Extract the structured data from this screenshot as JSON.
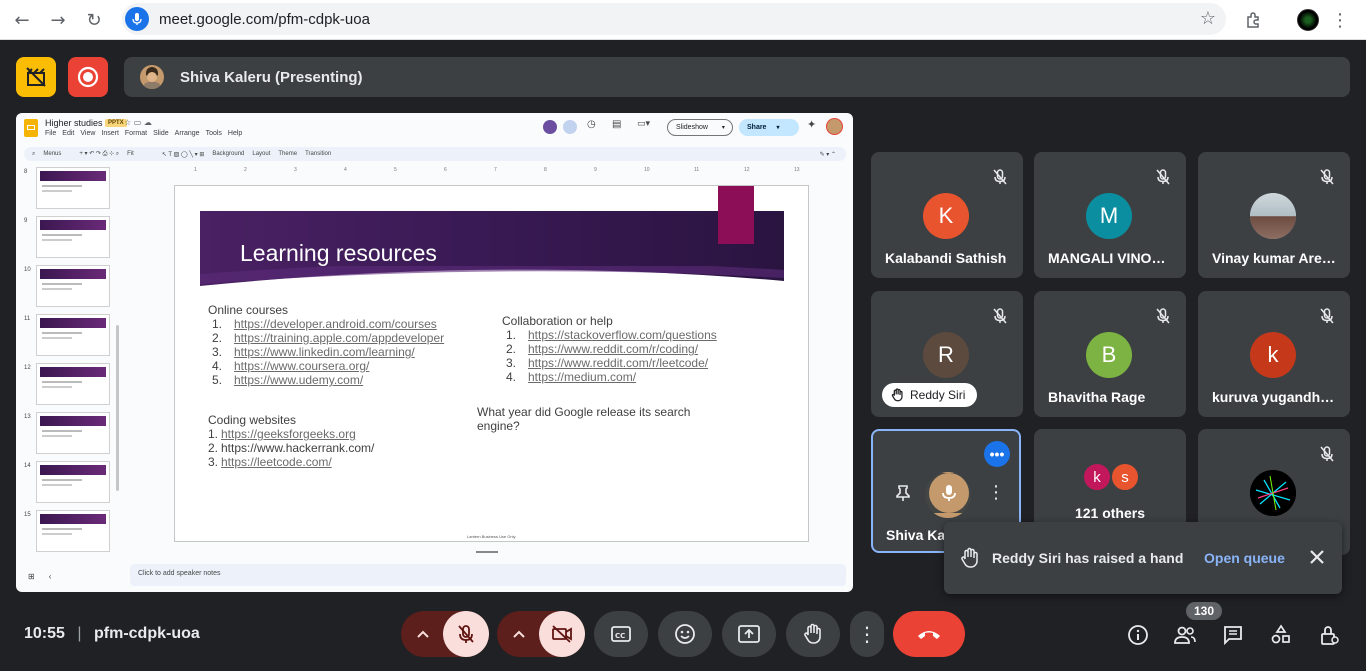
{
  "browser": {
    "url": "meet.google.com/pfm-cdpk-uoa"
  },
  "header": {
    "presenter_label": "Shiva Kaleru (Presenting)"
  },
  "slides_app": {
    "doc_title": "Higher studies",
    "file_badge": "PPTX",
    "menu": [
      "File",
      "Edit",
      "View",
      "Insert",
      "Format",
      "Slide",
      "Arrange",
      "Tools",
      "Help"
    ],
    "slideshow_label": "Slideshow",
    "share_label": "Share",
    "toolbar": {
      "menus": "Menus",
      "zoom": "Fit",
      "background": "Background",
      "layout": "Layout",
      "theme": "Theme",
      "transition": "Transition"
    },
    "thumbnail_numbers": [
      "8",
      "9",
      "10",
      "11",
      "12",
      "13",
      "14",
      "15"
    ],
    "ruler_ticks": [
      "1",
      "2",
      "3",
      "4",
      "5",
      "6",
      "7",
      "8",
      "9",
      "10",
      "11",
      "12",
      "13"
    ],
    "speaker_notes_placeholder": "Click to add speaker notes",
    "slide": {
      "title": "Learning resources",
      "online_heading": "Online courses",
      "online_items": [
        {
          "num": "1.",
          "text": "https://developer.android.com/courses"
        },
        {
          "num": "2.",
          "text": "https://training.apple.com/appdeveloper"
        },
        {
          "num": "3.",
          "text": "https://www.linkedin.com/learning/"
        },
        {
          "num": "4.",
          "text": "https://www.coursera.org/"
        },
        {
          "num": "5.",
          "text": "https://www.udemy.com/"
        }
      ],
      "collab_heading": "Collaboration or help",
      "collab_items": [
        {
          "num": "1.",
          "text": "https://stackoverflow.com/questions"
        },
        {
          "num": "2.",
          "text": "https://www.reddit.com/r/coding/"
        },
        {
          "num": "3.",
          "text": "https://www.reddit.com/r/leetcode/"
        },
        {
          "num": "4.",
          "text": "https://medium.com/"
        }
      ],
      "coding_heading": "Coding websites",
      "coding_items": [
        {
          "num": "1.",
          "text": "https://geeksforgeeks.org",
          "link": true
        },
        {
          "num": "2.",
          "text": "https://www.hackerrank.com/",
          "link": false
        },
        {
          "num": "3.",
          "text": "https://leetcode.com/",
          "link": true
        }
      ],
      "question": "What year did Google release its search engine?",
      "footer": "Lantern Business Use Only"
    }
  },
  "participants": [
    {
      "initial": "K",
      "name": "Kalabandi Sathish",
      "color": "#e8542e"
    },
    {
      "initial": "M",
      "name": "MANGALI VINO…",
      "color": "#0b8fa0"
    },
    {
      "initial": "",
      "name": "Vinay kumar Are…",
      "color": "#9aa0a6"
    },
    {
      "initial": "R",
      "name": "Reddy Siri",
      "color": "#5d4a3e"
    },
    {
      "initial": "B",
      "name": "Bhavitha Rage",
      "color": "#7cb342"
    },
    {
      "initial": "k",
      "name": "kuruva yugandh…",
      "color": "#c5391a"
    },
    {
      "initial": "",
      "name": "Shiva Kal",
      "color": "#c49a6c"
    },
    {
      "initial": "",
      "name": "121 others",
      "color": "#3c4043"
    },
    {
      "initial": "",
      "name": "",
      "color": "#000000"
    }
  ],
  "others_initials": [
    "k",
    "s"
  ],
  "toast": {
    "message": "Reddy Siri has raised a hand",
    "action": "Open queue"
  },
  "bottom_bar": {
    "time": "10:55",
    "meeting_code": "pfm-cdpk-uoa",
    "participant_count": "130"
  },
  "colors": {
    "background": "#202124",
    "tile": "#3c4043",
    "danger": "#ea4335",
    "accent": "#8ab4f8",
    "host_yellow": "#fbbc04"
  }
}
